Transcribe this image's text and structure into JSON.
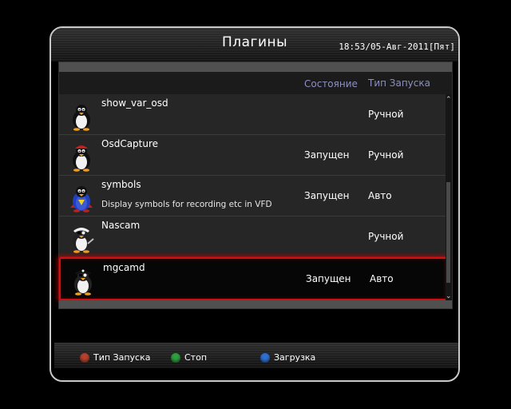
{
  "window": {
    "title": "Плагины",
    "clock": "18:53/05-Авг-2011[Пят]"
  },
  "columns": {
    "state": "Состояние",
    "type": "Тип Запуска"
  },
  "plugins": [
    {
      "name": "show_var_osd",
      "description": "",
      "state": "",
      "type": "Ручной",
      "icon": "penguin-icon"
    },
    {
      "name": "OsdCapture",
      "description": "",
      "state": "Запущен",
      "type": "Ручной",
      "icon": "penguin-icon"
    },
    {
      "name": "symbols",
      "description": "Display symbols for recording etc in VFD",
      "state": "Запущен",
      "type": "Авто",
      "icon": "penguin-superman-icon"
    },
    {
      "name": "Nascam",
      "description": "",
      "state": "",
      "type": "Ручной",
      "icon": "penguin-pirate-icon"
    },
    {
      "name": "mgcamd",
      "description": "",
      "state": "Запущен",
      "type": "Авто",
      "icon": "penguin-pirate-icon",
      "selected": true
    }
  ],
  "footer": {
    "red_label": "Тип Запуска",
    "green_label": "Стоп",
    "blue_label": "Загрузка"
  },
  "colors": {
    "red_button": "#c0392b",
    "green_button": "#2e9e3e",
    "blue_button": "#2f6fd0",
    "selection_border": "#d01010",
    "header_text": "#8d8fc4"
  },
  "scroll": {
    "up_symbol": "⌃",
    "down_symbol": "⌄"
  }
}
